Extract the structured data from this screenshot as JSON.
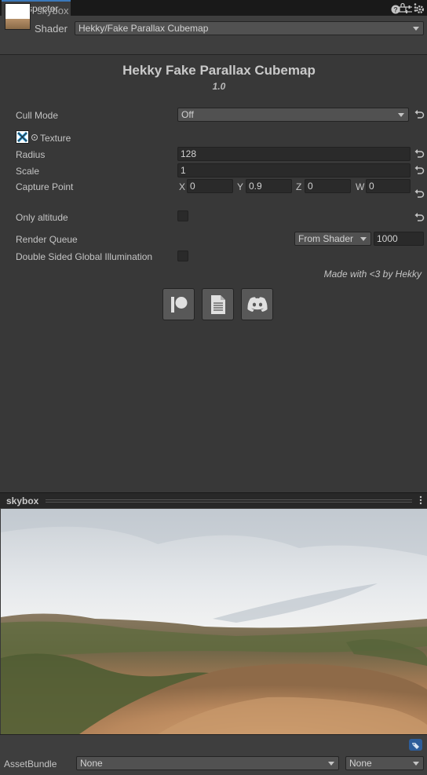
{
  "tab": {
    "label": "Inspector"
  },
  "header": {
    "material_name": "skybox",
    "shader_label": "Shader",
    "shader_value": "Hekky/Fake Parallax Cubemap"
  },
  "body": {
    "title": "Hekky Fake Parallax Cubemap",
    "version": "1.0",
    "cull_mode": {
      "label": "Cull Mode",
      "value": "Off"
    },
    "texture": {
      "label": "Texture"
    },
    "radius": {
      "label": "Radius",
      "value": "128"
    },
    "scale": {
      "label": "Scale",
      "value": "1"
    },
    "capture_point": {
      "label": "Capture Point",
      "x_label": "X",
      "x": "0",
      "y_label": "Y",
      "y": "0.9",
      "z_label": "Z",
      "z": "0",
      "w_label": "W",
      "w": "0"
    },
    "only_altitude": {
      "label": "Only altitude",
      "checked": false
    },
    "render_queue": {
      "label": "Render Queue",
      "mode": "From Shader",
      "value": "1000"
    },
    "double_sided_gi": {
      "label": "Double Sided Global Illumination",
      "checked": false
    },
    "made_with": "Made with <3 by Hekky",
    "links": [
      {
        "icon": "patreon-icon"
      },
      {
        "icon": "document-icon"
      },
      {
        "icon": "discord-icon"
      }
    ]
  },
  "preview": {
    "title": "skybox"
  },
  "footer": {
    "assetbundle_label": "AssetBundle",
    "assetbundle_name": "None",
    "assetbundle_variant": "None"
  },
  "colors": {
    "background": "#383838",
    "tab_accent": "#3a79bb",
    "field_bg": "#2a2a2a",
    "dropdown_bg": "#515151"
  }
}
